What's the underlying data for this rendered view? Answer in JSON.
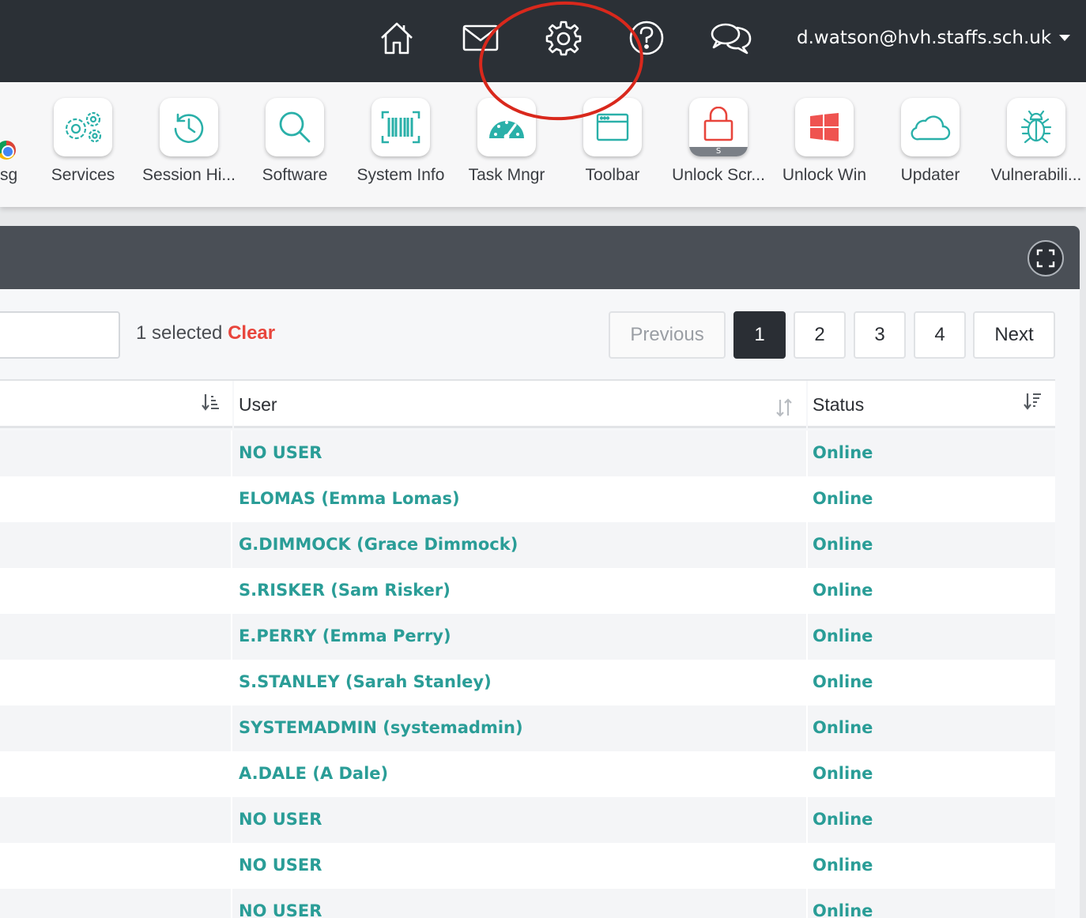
{
  "topbar": {
    "icons": [
      "home-icon",
      "mail-icon",
      "settings-gear-icon",
      "help-icon",
      "chat-icon"
    ],
    "user_email": "d.watson@hvh.staffs.sch.uk"
  },
  "toolbar": {
    "partial_label": "sg",
    "items": [
      {
        "label": "Services",
        "icon": "services-gears-icon"
      },
      {
        "label": "Session Hi...",
        "icon": "history-clock-icon"
      },
      {
        "label": "Software",
        "icon": "magnifier-icon"
      },
      {
        "label": "System Info",
        "icon": "barcode-icon"
      },
      {
        "label": "Task Mngr",
        "icon": "speedometer-icon"
      },
      {
        "label": "Toolbar",
        "icon": "browser-window-icon"
      },
      {
        "label": "Unlock Scr...",
        "icon": "padlock-icon",
        "badge": "S"
      },
      {
        "label": "Unlock Win",
        "icon": "windows-logo-icon"
      },
      {
        "label": "Updater",
        "icon": "cloud-icon"
      },
      {
        "label": "Vulnerabili...",
        "icon": "bug-icon"
      }
    ]
  },
  "selection": {
    "text": "1 selected",
    "clear_label": "Clear"
  },
  "pagination": {
    "previous": "Previous",
    "pages": [
      "1",
      "2",
      "3",
      "4"
    ],
    "current": "1",
    "next": "Next"
  },
  "table": {
    "headers": {
      "user": "User",
      "status": "Status"
    },
    "rows": [
      {
        "user": "NO USER",
        "status": "Online"
      },
      {
        "user": "ELOMAS (Emma Lomas)",
        "status": "Online"
      },
      {
        "user": "G.DIMMOCK (Grace Dimmock)",
        "status": "Online"
      },
      {
        "user": "S.RISKER (Sam Risker)",
        "status": "Online"
      },
      {
        "user": "E.PERRY (Emma Perry)",
        "status": "Online"
      },
      {
        "user": "S.STANLEY (Sarah Stanley)",
        "status": "Online"
      },
      {
        "user": "SYSTEMADMIN (systemadmin)",
        "status": "Online"
      },
      {
        "user": "A.DALE (A Dale)",
        "status": "Online"
      },
      {
        "user": "NO USER",
        "status": "Online"
      },
      {
        "user": "NO USER",
        "status": "Online"
      },
      {
        "user": "NO USER",
        "status": "Online"
      }
    ]
  },
  "colors": {
    "topbar": "#2b3036",
    "accent_teal": "#2a9d97",
    "clear_red": "#e8453c",
    "annotation_red": "#d9281c"
  }
}
